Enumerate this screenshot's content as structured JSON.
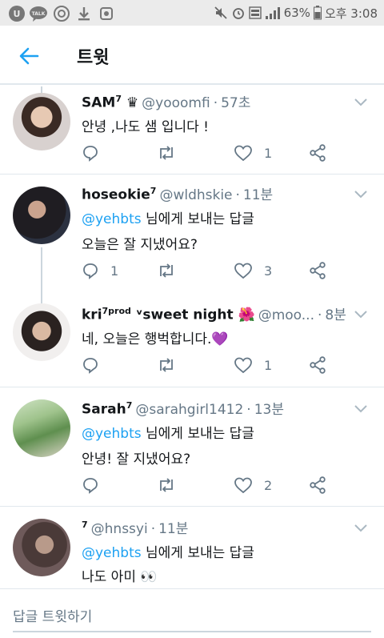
{
  "status_bar": {
    "battery": "63%",
    "time": "오후 3:08",
    "kakao_label": "TALK"
  },
  "header": {
    "title": "트윗"
  },
  "tweets": [
    {
      "name": "SAM",
      "name_sup": "7",
      "name_extra": "♛",
      "handle": "@yooomfi",
      "dot": "·",
      "time": "57초",
      "reply_mention": "",
      "reply_suffix": "",
      "text": "안녕 ,나도 샘 입니다 !",
      "reply_count": "",
      "like_count": "1"
    },
    {
      "name": "hoseokie",
      "name_sup": "7",
      "name_extra": "",
      "handle": "@wldhskie",
      "dot": "·",
      "time": "11분",
      "reply_mention": "@yehbts",
      "reply_suffix": " 님에게 보내는 답글",
      "text": "오늘은 잘 지냈어요?",
      "reply_count": "1",
      "like_count": "3"
    },
    {
      "name": "kri",
      "name_sup": "7prod",
      "name_extra": " ᵛsweet night 🌺",
      "handle": "@moo...",
      "dot": "·",
      "time": "8분",
      "reply_mention": "",
      "reply_suffix": "",
      "text": "네, 오늘은 행벅합니다.💜",
      "reply_count": "",
      "like_count": "1"
    },
    {
      "name": "Sarah",
      "name_sup": "7",
      "name_extra": "",
      "handle": "@sarahgirl1412",
      "dot": "·",
      "time": "13분",
      "reply_mention": "@yehbts",
      "reply_suffix": " 님에게 보내는 답글",
      "text": "안녕! 잘 지냈어요?",
      "reply_count": "",
      "like_count": "2"
    },
    {
      "name": "",
      "name_sup": "7",
      "name_extra": "",
      "handle": "@hnssyi",
      "dot": "·",
      "time": "11분",
      "reply_mention": "@yehbts",
      "reply_suffix": " 님에게 보내는 답글",
      "text": "나도 아미 👀",
      "reply_count": "",
      "like_count": ""
    }
  ],
  "reply_bar": {
    "placeholder": "답글 트윗하기"
  },
  "colors": {
    "accent": "#1da1f2",
    "muted": "#657786",
    "divider": "#e1e8ed"
  }
}
